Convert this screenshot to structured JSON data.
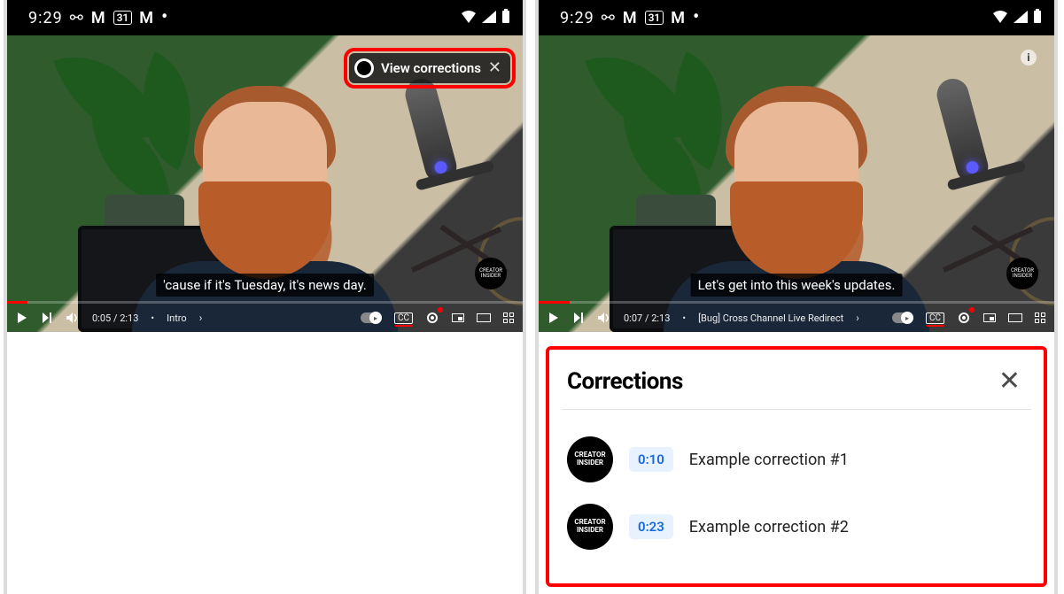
{
  "statusbar": {
    "time": "9:29",
    "calendar_day": "31",
    "gmail_glyph": "M",
    "voicemail_glyph": "⚯"
  },
  "left": {
    "view_corrections_label": "View corrections",
    "caption": "'cause if it's Tuesday, it's news day.",
    "controls": {
      "time": "0:05 / 2:13",
      "chapter": "Intro",
      "progress_percent": 4
    }
  },
  "right": {
    "caption": "Let's get into this week's updates.",
    "controls": {
      "time": "0:07 / 2:13",
      "chapter": "[Bug] Cross Channel Live Redirect",
      "progress_percent": 6
    },
    "corrections": {
      "title": "Corrections",
      "avatar_text": "CREATOR\nINSIDER",
      "items": [
        {
          "time": "0:10",
          "text": "Example correction #1"
        },
        {
          "time": "0:23",
          "text": "Example correction #2"
        }
      ]
    }
  }
}
